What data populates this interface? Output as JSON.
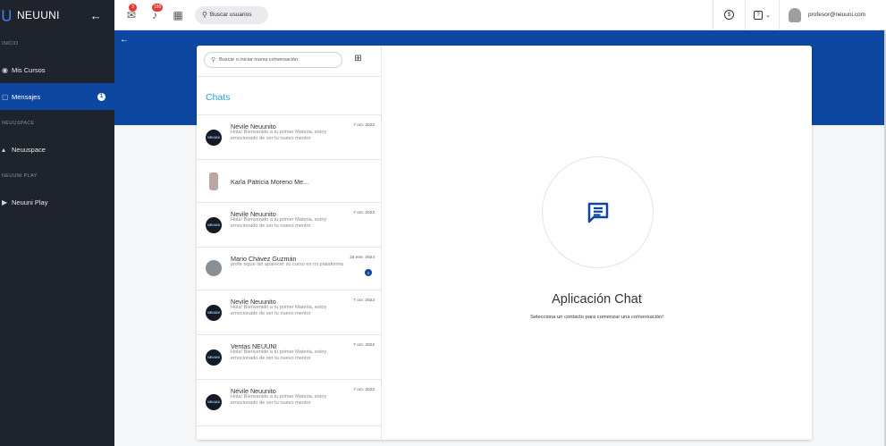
{
  "brand": {
    "logo": "⋃",
    "name": "NEUUNI",
    "back_icon": "arrow-left-icon"
  },
  "sidebar": {
    "sections": [
      {
        "label": "INICIO",
        "items": [
          {
            "label": "Mis Cursos",
            "icon": "book-icon"
          }
        ]
      },
      {
        "label": "",
        "items": [
          {
            "label": "Mensajes",
            "icon": "message-icon",
            "active": true,
            "count": "1"
          }
        ]
      },
      {
        "label": "NEUUSPACE",
        "items": [
          {
            "label": "Neuuspace",
            "icon": "space-icon"
          }
        ]
      },
      {
        "label": "NEUUNI PLAY",
        "items": [
          {
            "label": "Neuuni Play",
            "icon": "play-icon"
          }
        ]
      }
    ]
  },
  "topbar": {
    "messages_badge": "3",
    "notifications_badge": "180",
    "search_label": "Buscar usuarios",
    "coin_symbol": "$",
    "help_symbol": "?",
    "user_email": "profesor@neuuni.com"
  },
  "chat": {
    "search_placeholder": "Buscar o iniciar nueva conversación",
    "title": "Chats",
    "conversations": [
      {
        "name": "Nevile Neuunito",
        "message": "Hola! Bienvenido a tu primer Materia, estoy emocionado de ser tu nuevo mentor",
        "date": "7 oct. 2022",
        "avatar_text": "NEUUNI"
      },
      {
        "name": "Karla Patricia Moreno Me...",
        "message": "",
        "date": "",
        "avatar_text": ""
      },
      {
        "name": "Nevile Neuunito",
        "message": "Hola! Bienvenido a tu primer Materia, estoy emocionado de ser tu nuevo mentor",
        "date": "7 oct. 2022",
        "avatar_text": "NEUUNI"
      },
      {
        "name": "Mario Chávez Guzmán",
        "message": "profe sigue sin aparecer su curso en mi plataforma",
        "date": "18 ene. 2024",
        "unread": "1",
        "avatar_text": ""
      },
      {
        "name": "Nevile Neuunito",
        "message": "Hola! Bienvenido a tu primer Materia, estoy emocionado de ser tu nuevo mentor",
        "date": "7 oct. 2022",
        "avatar_text": "NEUUNI"
      },
      {
        "name": "Ventas NEUUNI",
        "message": "Hola! Bienvenido a tu primer Materia, estoy emocionado de ser tu nuevo mentor",
        "date": "7 oct. 2022",
        "avatar_text": "NEUUNI"
      },
      {
        "name": "Nevile Neuunito",
        "message": "Hola! Bienvenido a tu primer Materia, estoy emocionado de ser tu nuevo mentor",
        "date": "7 oct. 2022",
        "avatar_text": "NEUUNI"
      }
    ],
    "empty_title": "Aplicación Chat",
    "empty_subtitle": "Selecciona un contacto para comenzar una conversación!"
  },
  "colors": {
    "primary": "#0d47a1",
    "sidebar": "#1f232b",
    "chats_title": "#2aa3d8",
    "badge": "#e53935"
  }
}
